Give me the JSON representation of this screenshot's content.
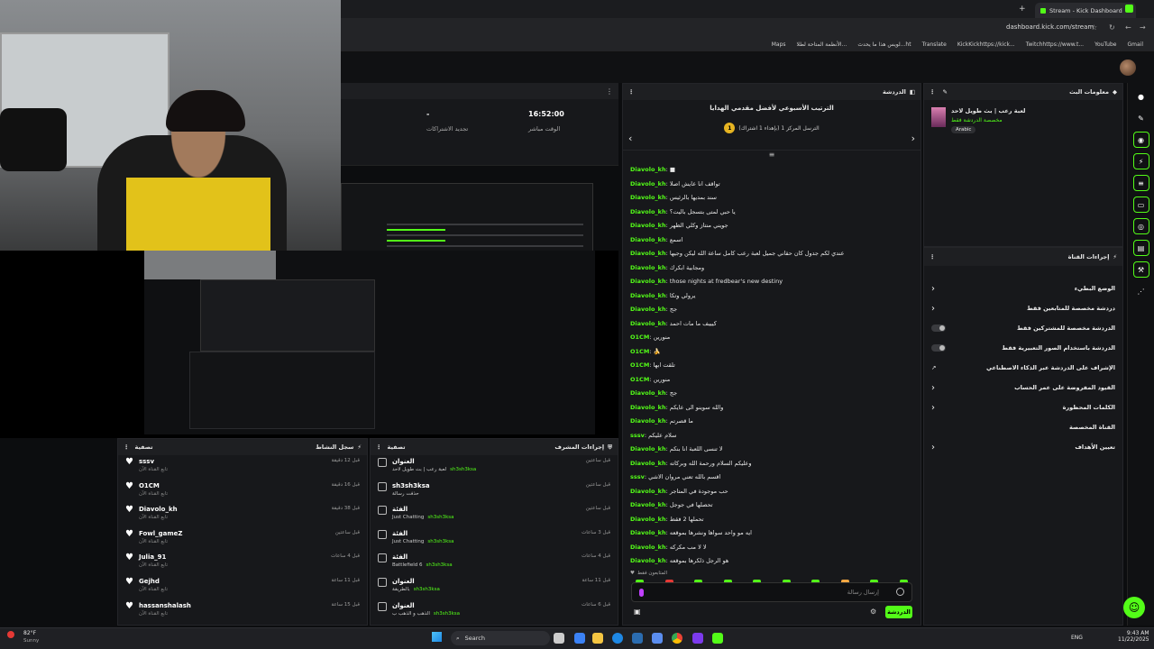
{
  "browser": {
    "tab_title": "Stream - Kick Dashboard",
    "url": "dashboard.kick.com/stream",
    "bookmarks": [
      "Maps",
      "الأنظمة المتاحة لطلا...",
      "لويس هذا ما يحدث...ht",
      "Translate",
      "KickKickhttps://kick...",
      "Twitchhttps://www.t...",
      "YouTube",
      "Gmail"
    ]
  },
  "stats": {
    "time_value": "16:52:00",
    "time_label": "الوقت مباشر",
    "subs_value": "-",
    "subs_label": "تجديد الاشتراكات"
  },
  "activity_feed": {
    "title": "سجل النشاط",
    "filter_label": "تصفية",
    "items": [
      {
        "user": "sssv",
        "sub": "تابع القناة الآن",
        "time": "قبل 12 دقيقة"
      },
      {
        "user": "O1CM",
        "sub": "تابع القناة الآن",
        "time": "قبل 16 دقيقة"
      },
      {
        "user": "Diavolo_kh",
        "sub": "تابع القناة الآن",
        "time": "قبل 38 دقيقة"
      },
      {
        "user": "Fowl_gameZ",
        "sub": "تابع القناة الآن",
        "time": "قبل ساعتين"
      },
      {
        "user": "Julia_91",
        "sub": "تابع القناة الآن",
        "time": "قبل 4 ساعات"
      },
      {
        "user": "Gejhd",
        "sub": "تابع القناة الآن",
        "time": "قبل 11 ساعة"
      },
      {
        "user": "hassanshalash",
        "sub": "تابع القناة الآن",
        "time": "قبل 15 ساعة"
      }
    ]
  },
  "mod_actions": {
    "title": "إجراءات المشرف",
    "filter_label": "تصفية",
    "items": [
      {
        "head": "العنوان",
        "body": "لعبة رعب | بث طويل لاحد",
        "by": "sh3sh3ksa",
        "time": "قبل ساعتين"
      },
      {
        "head": "sh3sh3ksa",
        "body": "حذفت رسالة",
        "by": "",
        "time": "قبل ساعتين"
      },
      {
        "head": "الفئة",
        "body": "Just Chatting",
        "by": "sh3sh3ksa",
        "time": "قبل ساعتين"
      },
      {
        "head": "الفئة",
        "body": "Just Chatting",
        "by": "sh3sh3ksa",
        "time": "قبل 3 ساعات"
      },
      {
        "head": "الفئة",
        "body": "Battlefield 6",
        "by": "sh3sh3ksa",
        "time": "قبل 4 ساعات"
      },
      {
        "head": "العنوان",
        "body": "بالطريقة",
        "by": "sh3sh3ksa",
        "time": "قبل 11 ساعة"
      },
      {
        "head": "العنوان",
        "body": "الذهب و الذهب ب",
        "by": "sh3sh3ksa",
        "time": "قبل 6 ساعات"
      }
    ]
  },
  "chat": {
    "title": "الدردشة",
    "pinned_title": "الترتيب الأسبوعي لأفضل مقدمي الهدايا",
    "pinned_sub": "(بإهداء 1 اشتراك) الترسل المركز 1",
    "rank": "1",
    "messages": [
      {
        "user": "Diavolo_kh",
        "text": "■"
      },
      {
        "user": "Diavolo_kh",
        "text": "تواقف انا عايش اصلا"
      },
      {
        "user": "Diavolo_kh",
        "text": "سند بمديها بالرئيس"
      },
      {
        "user": "Diavolo_kh",
        "text": "يا حبي لمتى بتسجل باليت؟"
      },
      {
        "user": "Diavolo_kh",
        "text": "جويني منتاز وكلي الظهر"
      },
      {
        "user": "Diavolo_kh",
        "text": "اسمع"
      },
      {
        "user": "Diavolo_kh",
        "text": "عندي لكم جدول كان حقاني جميل لعبة رعب كامل ساعة الله ليكن وجيها"
      },
      {
        "user": "Diavolo_kh",
        "text": "ومجابية ابكرك"
      },
      {
        "user": "Diavolo_kh",
        "text": "those nights at fredbear's new destiny"
      },
      {
        "user": "Diavolo_kh",
        "text": "يرولي وتكا"
      },
      {
        "user": "Diavolo_kh",
        "text": "جج"
      },
      {
        "user": "Diavolo_kh",
        "text": "كيييف ما مات احمد"
      },
      {
        "user": "O1CM",
        "text": "منورين"
      },
      {
        "user": "O1CM",
        "text": "🍌"
      },
      {
        "user": "O1CM",
        "text": "تلقت ابها"
      },
      {
        "user": "O1CM",
        "text": "منورين"
      },
      {
        "user": "Diavolo_kh",
        "text": "جج"
      },
      {
        "user": "Diavolo_kh",
        "text": "والله سوينو الى عايكم"
      },
      {
        "user": "Diavolo_kh",
        "text": "ما قصرتم"
      },
      {
        "user": "sssv",
        "text": "سلام عليكم"
      },
      {
        "user": "Diavolo_kh",
        "text": "لا تنسى اللعبة انا بنكم"
      },
      {
        "user": "Diavolo_kh",
        "text": "وعليكم السلام ورحمة الله وبركاته"
      },
      {
        "user": "sssv",
        "text": "اقسم بالله تعني مروان الاشي"
      },
      {
        "user": "Diavolo_kh",
        "text": "حب موجودة في المتاجر"
      },
      {
        "user": "Diavolo_kh",
        "text": "تحصلها في جوجل"
      },
      {
        "user": "Diavolo_kh",
        "text": "تحملها 2 فقط"
      },
      {
        "user": "Diavolo_kh",
        "text": "ايه مو واحد سواها ونشرها بموقعه"
      },
      {
        "user": "Diavolo_kh",
        "text": "لا لا مب مكركه"
      },
      {
        "user": "Diavolo_kh",
        "text": "هو الرجل ذلكرها بموقعه"
      }
    ],
    "followers_note": "المتابعون فقط",
    "input_placeholder": "إرسال رسالة",
    "send_label": "الدردشة"
  },
  "stream_info": {
    "title": "معلومات البث",
    "stream_title": "لعبة رعب | بث طويل لاحد",
    "category": "مخصصة الدردشة فقط",
    "language": "Arabic"
  },
  "channel_actions": {
    "title": "إجراءات القناة",
    "rows": [
      {
        "label": "الوضع البطيء",
        "control": "chevron"
      },
      {
        "label": "دردشة مخصصة للمتابعين فقط",
        "control": "chevron"
      },
      {
        "label": "الدردشة مخصصة للمشتركين فقط",
        "control": "toggle"
      },
      {
        "label": "الدردشة باستخدام الصور التعبيرية فقط",
        "control": "toggle"
      },
      {
        "label": "الإشراف على الدردشة عبر الذكاء الاصطناعي",
        "control": "link"
      },
      {
        "label": "القيود المفروضة على عمر الحساب",
        "control": "chevron"
      },
      {
        "label": "الكلمات المحظورة",
        "control": "chevron"
      },
      {
        "label": "القناة المخصصة",
        "control": "none"
      },
      {
        "label": "تعيين الأهداف",
        "control": "chevron"
      }
    ]
  },
  "taskbar": {
    "weather_temp": "82°F",
    "weather_desc": "Sunny",
    "search_label": "Search",
    "lang": "ENG",
    "time": "9:43 AM",
    "date": "11/22/2025"
  },
  "colors": {
    "accent": "#53fc18",
    "bg": "#0c0d0f",
    "panel": "#17181b"
  }
}
